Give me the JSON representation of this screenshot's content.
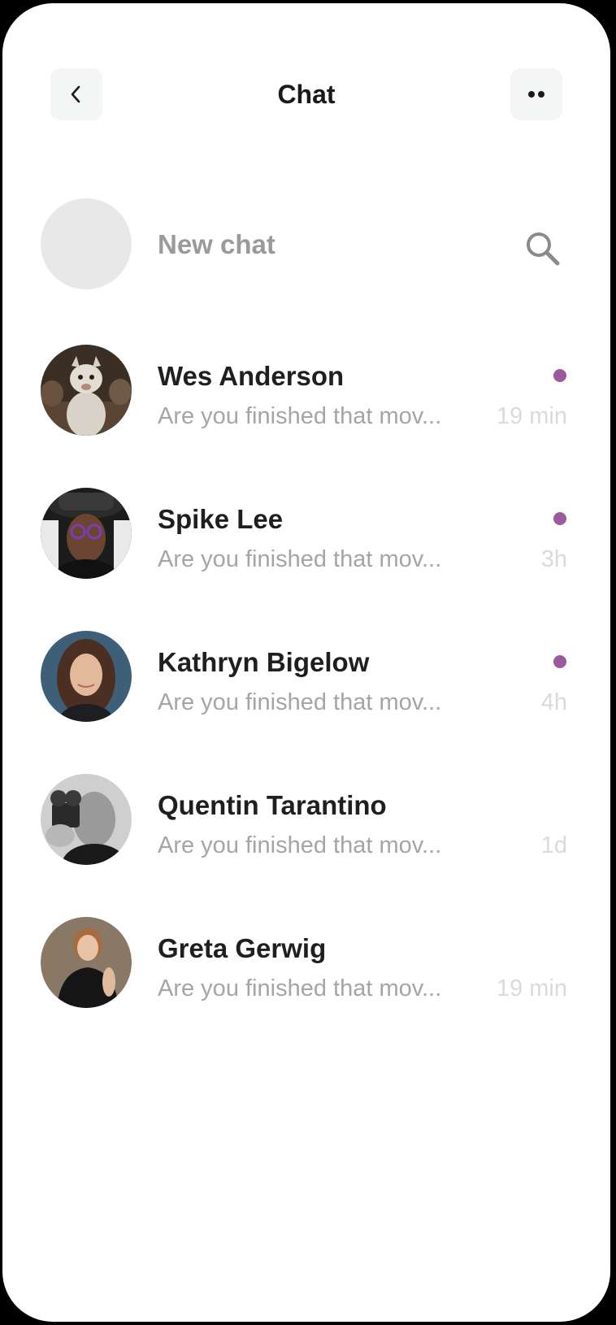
{
  "header": {
    "title": "Chat",
    "back_icon": "chevron-left-icon",
    "more_icon": "more-dots-icon"
  },
  "new_chat": {
    "label": "New chat",
    "search_icon": "search-icon"
  },
  "colors": {
    "unread": "#9b5a9a",
    "button_bg": "#f4f5f5",
    "placeholder_avatar": "#e8e8e8"
  },
  "chats": [
    {
      "name": "Wes Anderson",
      "preview": "Are you finished that mov...",
      "time": "19 min",
      "unread": true
    },
    {
      "name": "Spike Lee",
      "preview": "Are you finished that mov...",
      "time": "3h",
      "unread": true
    },
    {
      "name": "Kathryn Bigelow",
      "preview": "Are you finished that mov...",
      "time": "4h",
      "unread": true
    },
    {
      "name": "Quentin Tarantino",
      "preview": "Are you finished that mov...",
      "time": "1d",
      "unread": false
    },
    {
      "name": "Greta Gerwig",
      "preview": "Are you finished that mov...",
      "time": "19 min",
      "unread": false
    }
  ]
}
